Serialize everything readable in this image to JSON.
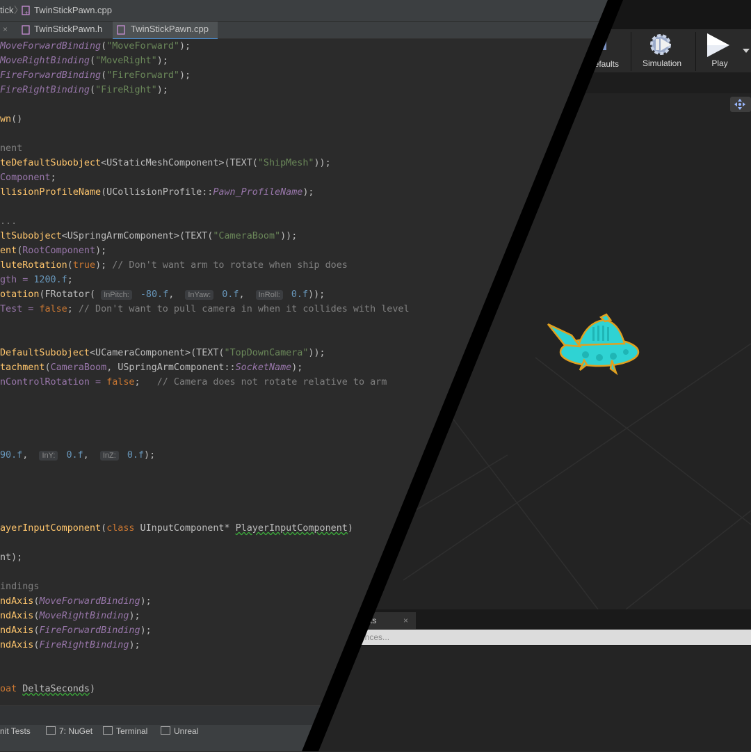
{
  "breadcrumb": {
    "root": "tick",
    "separator": "〉",
    "file": "TwinStickPawn.cpp"
  },
  "tabs": [
    {
      "label": "TwinStickPawn.h",
      "close": "×"
    },
    {
      "label": "TwinStickPawn.cpp",
      "close": "×"
    }
  ],
  "code": {
    "l1": [
      "MoveForwardBinding",
      "(",
      "\"MoveForward\"",
      ");"
    ],
    "l2": [
      "MoveRightBinding",
      "(",
      "\"MoveRight\"",
      ");"
    ],
    "l3": [
      "FireForwardBinding",
      "(",
      "\"FireForward\"",
      ");"
    ],
    "l4": [
      "FireRightBinding",
      "(",
      "\"FireRight\"",
      ");"
    ],
    "l6": [
      "wn",
      "()"
    ],
    "l8": [
      "nent"
    ],
    "l9": [
      "teDefaultSubobject",
      "<UStaticMeshComponent>(TEXT(",
      "\"ShipMesh\"",
      "));"
    ],
    "l10": [
      "Component",
      ";"
    ],
    "l11": [
      "llisionProfileName",
      "(UCollisionProfile::",
      "Pawn_ProfileName",
      ");"
    ],
    "l13": [
      "..."
    ],
    "l14": [
      "ltSubobject",
      "<USpringArmComponent>(TEXT(",
      "\"CameraBoom\"",
      "));"
    ],
    "l15": [
      "ent",
      "(",
      "RootComponent",
      ");"
    ],
    "l16": [
      "luteRotation",
      "(",
      "true",
      "); ",
      "// Don't want arm to rotate when ship does"
    ],
    "l17": [
      "gth = ",
      "1200.f",
      ";"
    ],
    "l18": [
      "otation",
      "(FRotator( ",
      "InPitch:",
      " -80.f",
      ",  ",
      "InYaw:",
      " 0.f",
      ",  ",
      "InRoll:",
      " 0.f",
      "));"
    ],
    "l19": [
      "Test = ",
      "false",
      "; ",
      "// Don't want to pull camera in when it collides with level"
    ],
    "l22": [
      "DefaultSubobject",
      "<UCameraComponent>(TEXT(",
      "\"TopDownCamera\"",
      "));"
    ],
    "l23": [
      "tachment",
      "(",
      "CameraBoom",
      ", USpringArmComponent::",
      "SocketName",
      ");"
    ],
    "l24": [
      "nControlRotation = ",
      "false",
      ";   ",
      "// Camera does not rotate relative to arm"
    ],
    "l29": [
      "90.f",
      ",  ",
      "InY:",
      " 0.f",
      ",  ",
      "InZ:",
      " 0.f",
      ");"
    ],
    "l34": [
      "ayerInputComponent",
      "(",
      "class",
      " UInputComponent* ",
      "PlayerInputComponent",
      ")"
    ],
    "l36": [
      "nt",
      ");"
    ],
    "l38": [
      "indings"
    ],
    "l39": [
      "ndAxis",
      "(",
      "MoveForwardBinding",
      ");"
    ],
    "l40": [
      "ndAxis",
      "(",
      "MoveRightBinding",
      ");"
    ],
    "l41": [
      "ndAxis",
      "(",
      "FireForwardBinding",
      ");"
    ],
    "l42": [
      "ndAxis",
      "(",
      "FireRightBinding",
      ");"
    ],
    "l45": [
      "oat ",
      "DeltaSeconds",
      ")"
    ]
  },
  "toolwindows": [
    "nit Tests",
    "7: NuGet",
    "Terminal",
    "Unreal"
  ],
  "unreal": {
    "toolbar": {
      "defaults_label": "efaults",
      "simulation_label": "Simulation",
      "play_label": "Play"
    },
    "panel_tab": "ts",
    "panel_tab_close": "×",
    "search_placeholder": "ences..."
  },
  "colors": {
    "accent": "#4a88c7",
    "ship": "#2fd3d3",
    "ship_outline": "#e0a020"
  }
}
